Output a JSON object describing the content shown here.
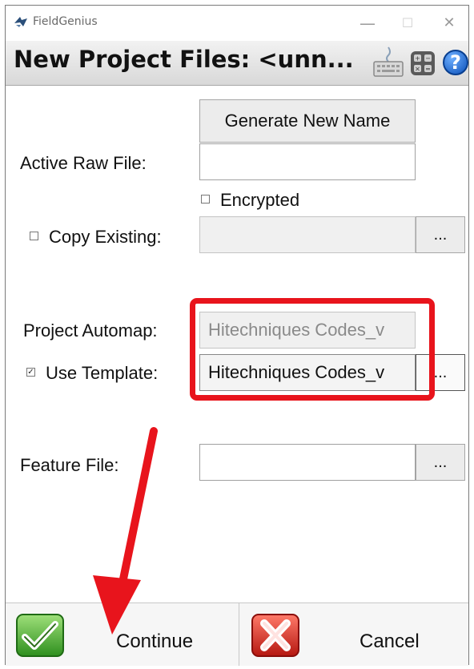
{
  "window": {
    "app_title": "FieldGenius",
    "minimize_glyph": "—",
    "maximize_glyph": "☐",
    "close_glyph": "✕"
  },
  "header": {
    "title": "New Project Files: <unn...",
    "icons": [
      "keyboard-icon",
      "calculator-icon",
      "help-icon"
    ],
    "help_glyph": "?"
  },
  "form": {
    "generate_button_label": "Generate New Name",
    "active_raw_file_label": "Active Raw File:",
    "active_raw_file_value": "",
    "encrypted_label": "Encrypted",
    "encrypted_checked": false,
    "copy_existing_label": "Copy Existing:",
    "copy_existing_checked": false,
    "copy_existing_value": "",
    "project_automap_label": "Project Automap:",
    "project_automap_value": "Hitechniques Codes_v",
    "use_template_label": "Use Template:",
    "use_template_checked": true,
    "use_template_value": "Hitechniques Codes_v",
    "feature_file_label": "Feature File:",
    "feature_file_value": "",
    "browse_label": "...",
    "checked_glyph": "✓",
    "unchecked_glyph": ""
  },
  "footer": {
    "continue_label": "Continue",
    "cancel_label": "Cancel"
  },
  "annotations": {
    "highlight_color": "#e8141c",
    "arrow_color": "#e8141c"
  }
}
